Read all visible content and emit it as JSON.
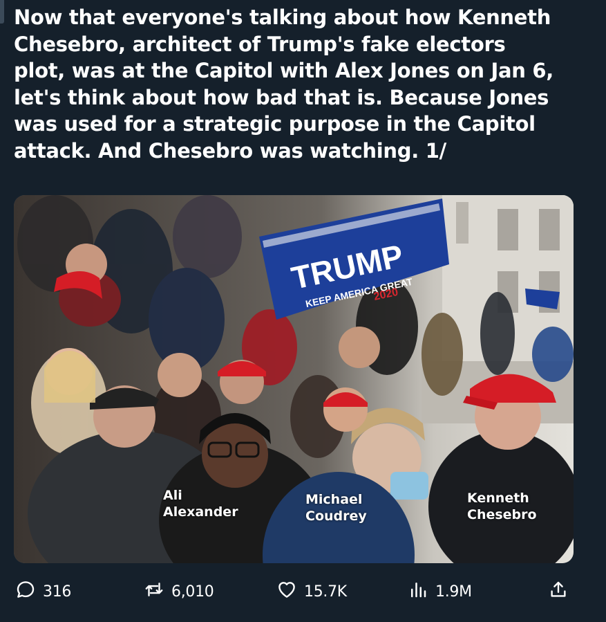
{
  "tweet": {
    "text": "Now that everyone's talking about how Kenneth\nChesebro, architect of Trump's fake electors\nplot, was at the Capitol with Alex Jones on Jan 6,\nlet's think about how bad that is. Because Jones\nwas used for a strategic purpose in the Capitol\nattack. And Chesebro was watching. 1/"
  },
  "media": {
    "banner_text": "TRUMP",
    "banner_subtext": "KEEP AMERICA GREAT",
    "banner_year": "2020",
    "captions": [
      {
        "label": "Ali\nAlexander"
      },
      {
        "label": "Michael\nCoudrey"
      },
      {
        "label": "Kenneth\nChesebro"
      }
    ]
  },
  "actions": {
    "replies": "316",
    "reposts": "6,010",
    "likes": "15.7K",
    "views": "1.9M"
  },
  "icons": [
    "reply-icon",
    "repost-icon",
    "like-icon",
    "views-icon",
    "share-icon"
  ]
}
